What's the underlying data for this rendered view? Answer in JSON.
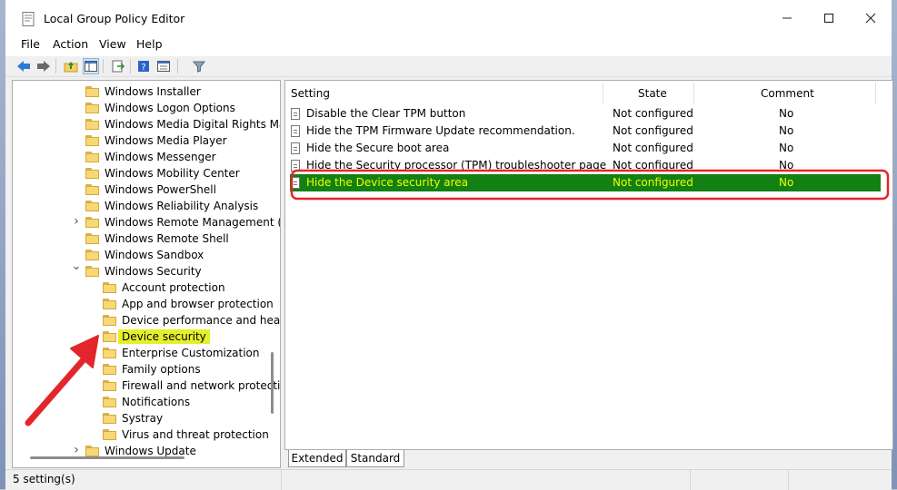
{
  "window": {
    "title": "Local Group Policy Editor"
  },
  "menu": [
    "File",
    "Action",
    "View",
    "Help"
  ],
  "tree": {
    "items": [
      {
        "label": "Windows Installer",
        "level": 0
      },
      {
        "label": "Windows Logon Options",
        "level": 0
      },
      {
        "label": "Windows Media Digital Rights Ma",
        "level": 0
      },
      {
        "label": "Windows Media Player",
        "level": 0
      },
      {
        "label": "Windows Messenger",
        "level": 0
      },
      {
        "label": "Windows Mobility Center",
        "level": 0
      },
      {
        "label": "Windows PowerShell",
        "level": 0
      },
      {
        "label": "Windows Reliability Analysis",
        "level": 0
      },
      {
        "label": "Windows Remote Management (",
        "level": 0,
        "expander": "collapsed"
      },
      {
        "label": "Windows Remote Shell",
        "level": 0
      },
      {
        "label": "Windows Sandbox",
        "level": 0
      },
      {
        "label": "Windows Security",
        "level": 0,
        "expander": "expanded"
      },
      {
        "label": "Account protection",
        "level": 1
      },
      {
        "label": "App and browser protection",
        "level": 1
      },
      {
        "label": "Device performance and healt",
        "level": 1
      },
      {
        "label": "Device security",
        "level": 1,
        "highlighted": true
      },
      {
        "label": "Enterprise Customization",
        "level": 1
      },
      {
        "label": "Family options",
        "level": 1
      },
      {
        "label": "Firewall and network protectio",
        "level": 1
      },
      {
        "label": "Notifications",
        "level": 1
      },
      {
        "label": "Systray",
        "level": 1
      },
      {
        "label": "Virus and threat protection",
        "level": 1
      },
      {
        "label": "Windows Update",
        "level": 0,
        "expander": "collapsed"
      }
    ],
    "highlight_color": "#e5f02a"
  },
  "list": {
    "columns": {
      "setting": "Setting",
      "state": "State",
      "comment": "Comment"
    },
    "rows": [
      {
        "setting": "Disable the Clear TPM button",
        "state": "Not configured",
        "comment": "No"
      },
      {
        "setting": "Hide the TPM Firmware Update recommendation.",
        "state": "Not configured",
        "comment": "No"
      },
      {
        "setting": "Hide the Secure boot area",
        "state": "Not configured",
        "comment": "No"
      },
      {
        "setting": "Hide the Security processor (TPM) troubleshooter page",
        "state": "Not configured",
        "comment": "No"
      },
      {
        "setting": "Hide the Device security area",
        "state": "Not configured",
        "comment": "No",
        "selected": true
      }
    ],
    "selected_bg": "#128012",
    "selected_fg": "#f0ff00",
    "callout_color": "#e3262b"
  },
  "tabs": [
    "Extended",
    "Standard"
  ],
  "status": {
    "text": "5 setting(s)"
  }
}
